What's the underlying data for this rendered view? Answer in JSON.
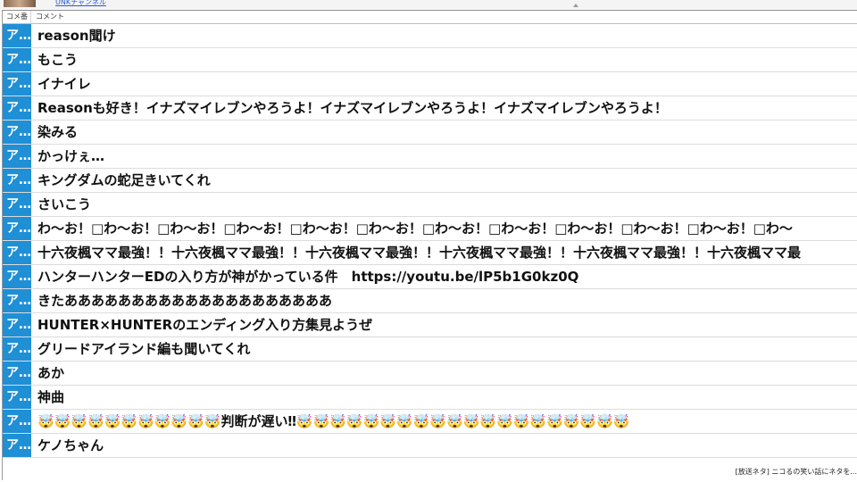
{
  "topbar": {
    "channel_link": "UNKチャンネル"
  },
  "header": {
    "col_number": "コメ番",
    "col_comment": "コメント"
  },
  "rows": [
    {
      "no": "ア…",
      "text": "reason聞け"
    },
    {
      "no": "ア…",
      "text": "もこう"
    },
    {
      "no": "ア…",
      "text": "イナイレ"
    },
    {
      "no": "ア…",
      "text": "Reasonも好き！イナズマイレブンやろうよ！イナズマイレブンやろうよ！イナズマイレブンやろうよ！"
    },
    {
      "no": "ア…",
      "text": "染みる"
    },
    {
      "no": "ア…",
      "text": "かっけぇ…"
    },
    {
      "no": "ア…",
      "text": "キングダムの蛇足きいてくれ"
    },
    {
      "no": "ア…",
      "text": "さいこう"
    },
    {
      "no": "ア…",
      "text": "わ～お！□わ～お！□わ～お！□わ～お！□わ～お！□わ～お！□わ～お！□わ～お！□わ～お！□わ～お！□わ～お！□わ～"
    },
    {
      "no": "ア…",
      "text": "十六夜楓ママ最強！！十六夜楓ママ最強！！十六夜楓ママ最強！！十六夜楓ママ最強！！十六夜楓ママ最強！！十六夜楓ママ最"
    },
    {
      "no": "ア…",
      "text": "ハンターハンターEDの入り方が神がかっている件　https://youtu.be/lP5b1G0kz0Q"
    },
    {
      "no": "ア…",
      "text": "きたああああああああああああああああああああ"
    },
    {
      "no": "ア…",
      "text": "HUNTER×HUNTERのエンディング入り方集見ようぜ"
    },
    {
      "no": "ア…",
      "text": "グリードアイランド編も聞いてくれ"
    },
    {
      "no": "ア…",
      "text": "あか"
    },
    {
      "no": "ア…",
      "text": "神曲"
    },
    {
      "no": "ア…",
      "text": "🤯🤯🤯🤯🤯🤯🤯🤯🤯🤯🤯判断が遅い‼🤯🤯🤯🤯🤯🤯🤯🤯🤯🤯🤯🤯🤯🤯🤯🤯🤯🤯🤯🤯"
    },
    {
      "no": "ア…",
      "text": "ケノちゃん"
    }
  ],
  "footer": {
    "ticker": "[放送ネタ] ニコるの笑い話にネタを..."
  },
  "colors": {
    "number_cell_bg": "#1f8fd6",
    "row_text": "#111111",
    "row_divider": "#dcdcdc"
  }
}
